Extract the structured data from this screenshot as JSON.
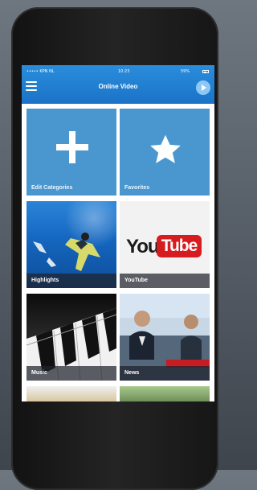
{
  "status_bar": {
    "carrier": "••••• KPN NL",
    "time": "10:23",
    "battery": "59%"
  },
  "header": {
    "title": "Online Video",
    "menu_icon": "hamburger-menu-icon",
    "play_icon": "play-circle-icon"
  },
  "tiles": [
    {
      "label": "Edit Categories",
      "icon": "plus-icon"
    },
    {
      "label": "Favorites",
      "icon": "star-icon"
    },
    {
      "label": "Highlights"
    },
    {
      "label": "YouTube",
      "logo_you": "You",
      "logo_tube": "Tube"
    },
    {
      "label": "Music"
    },
    {
      "label": "News"
    }
  ],
  "colors": {
    "header_blue": "#1b73c7",
    "tile_blue": "#4a97cf",
    "youtube_red": "#d71c1f"
  }
}
